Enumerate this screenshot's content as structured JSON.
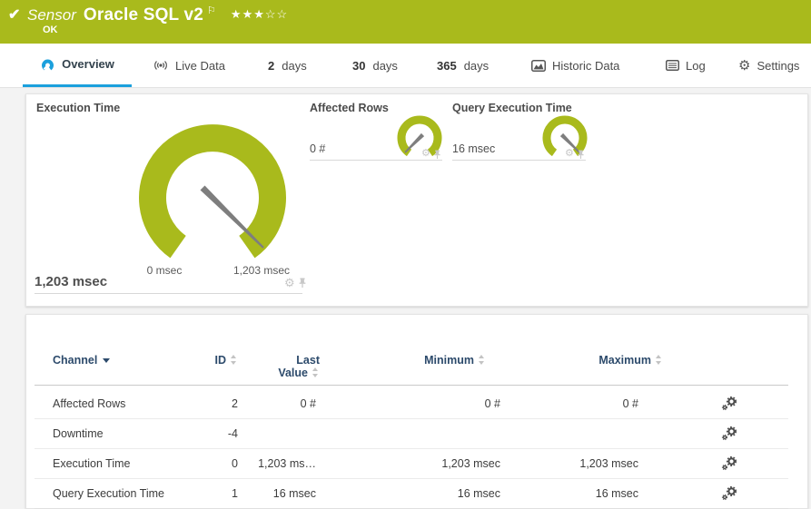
{
  "colors": {
    "brand_green": "#a9ba1c",
    "accent_blue": "#1ba0dd",
    "header_navy": "#2c4a6b",
    "needle_gray": "#7e7e7e"
  },
  "header": {
    "check_icon": "✔",
    "kind": "Sensor",
    "title": "Oracle SQL v2",
    "flag_icon": "⚐",
    "stars_filled": "★★★",
    "stars_empty": "☆☆",
    "status": "OK"
  },
  "tabs": {
    "overview": "Overview",
    "live_data": "Live Data",
    "d2_num": "2",
    "d2_label": "days",
    "d30_num": "30",
    "d30_label": "days",
    "d365_num": "365",
    "d365_label": "days",
    "historic": "Historic Data",
    "log": "Log",
    "settings": "Settings"
  },
  "icons": {
    "gear_glyph": "⚙"
  },
  "gauges": {
    "execution_time": {
      "title": "Execution Time",
      "value": "1,203 msec",
      "scale_min": "0 msec",
      "scale_max": "1,203 msec",
      "needle_position": "max"
    },
    "affected_rows": {
      "title": "Affected Rows",
      "value": "0 #",
      "needle_position": "min"
    },
    "query_execution_time": {
      "title": "Query Execution Time",
      "value": "16 msec",
      "needle_position": "max"
    }
  },
  "table": {
    "columns": {
      "channel": "Channel",
      "id": "ID",
      "last_line1": "Last",
      "last_line2": "Value",
      "minimum": "Minimum",
      "maximum": "Maximum"
    },
    "rows": [
      {
        "channel": "Affected Rows",
        "id": "2",
        "last": "0 #",
        "min": "0 #",
        "max": "0 #"
      },
      {
        "channel": "Downtime",
        "id": "-4",
        "last": "",
        "min": "",
        "max": ""
      },
      {
        "channel": "Execution Time",
        "id": "0",
        "last": "1,203 ms…",
        "min": "1,203 msec",
        "max": "1,203 msec"
      },
      {
        "channel": "Query Execution Time",
        "id": "1",
        "last": "16 msec",
        "min": "16 msec",
        "max": "16 msec"
      }
    ]
  }
}
